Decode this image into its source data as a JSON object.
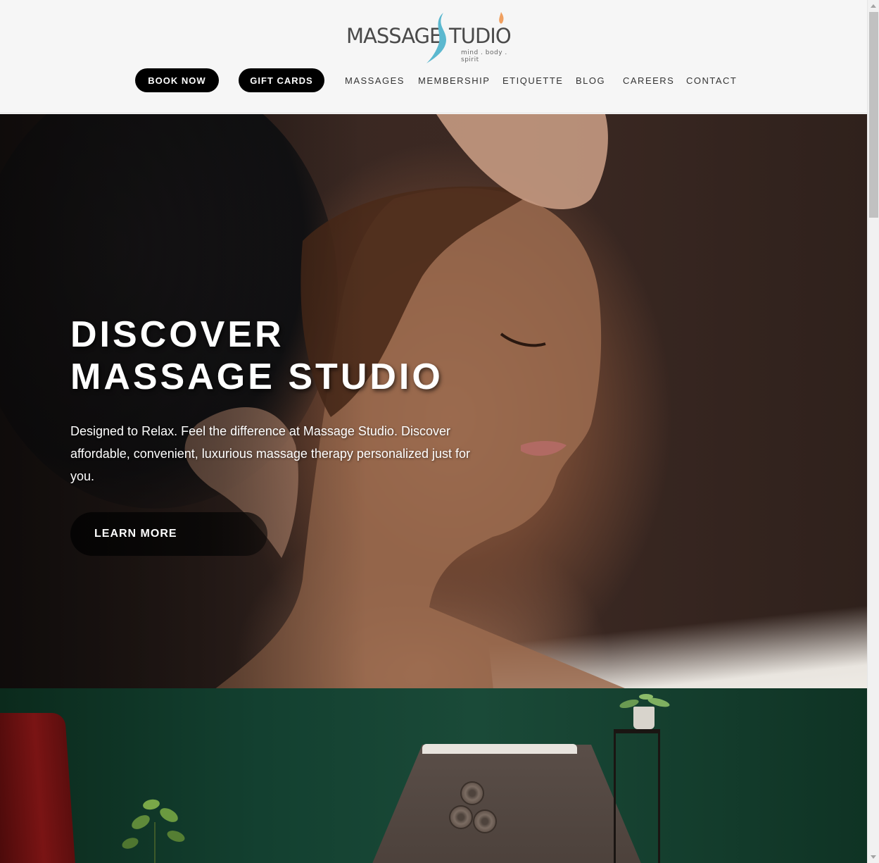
{
  "logo": {
    "word_left": "MASSAGE",
    "word_right": "TUDIO",
    "tagline": "mind . body . spirit",
    "colors": {
      "text": "#4a4a4a",
      "swoosh": "#5bb8cf",
      "flame": "#f0a060"
    }
  },
  "nav": {
    "book_now": "BOOK NOW",
    "gift_cards": "GIFT CARDS",
    "links": [
      "MASSAGES",
      "MEMBERSHIP",
      "ETIQUETTE",
      "BLOG",
      "CAREERS",
      "CONTACT"
    ]
  },
  "hero": {
    "title_line1": "DISCOVER",
    "title_line2": "MASSAGE STUDIO",
    "subtitle": "Designed to Relax. Feel the difference at Massage Studio. Discover affordable, convenient, luxurious massage therapy personalized just for you.",
    "cta": "LEARN MORE"
  },
  "colors": {
    "header_bg": "#f6f6f6",
    "pill_bg": "#000000",
    "nav_text": "#333333",
    "room_green": "#134030"
  }
}
